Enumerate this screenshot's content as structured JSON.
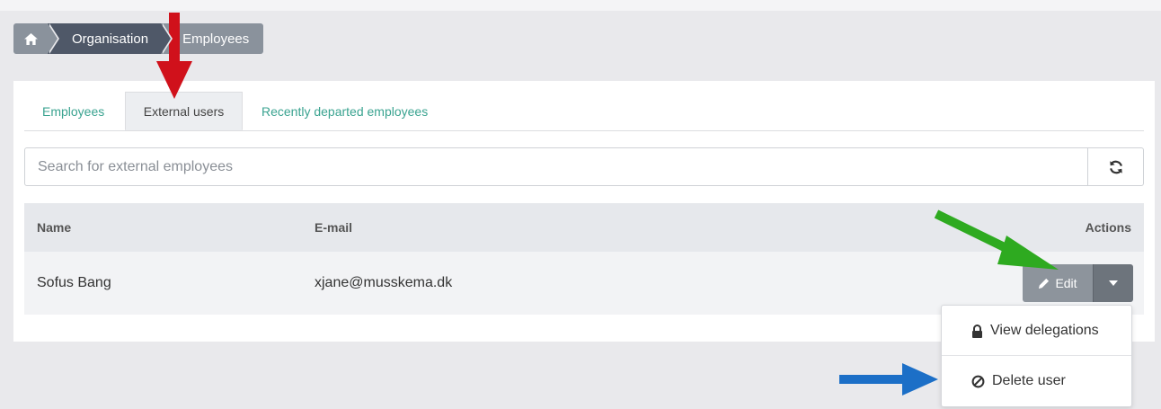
{
  "breadcrumb": {
    "home_icon": "home-icon",
    "items": [
      "Organisation",
      "Employees"
    ]
  },
  "tabs": [
    {
      "label": "Employees",
      "active": false
    },
    {
      "label": "External users",
      "active": true
    },
    {
      "label": "Recently departed employees",
      "active": false
    }
  ],
  "search": {
    "placeholder": "Search for external employees",
    "value": "",
    "refresh_icon": "refresh-icon"
  },
  "table": {
    "headers": {
      "name": "Name",
      "email": "E-mail",
      "actions": "Actions"
    },
    "rows": [
      {
        "name": "Sofus Bang",
        "email": "xjane@musskema.dk"
      }
    ]
  },
  "actions": {
    "edit_label": "Edit",
    "edit_icon": "pencil-icon",
    "caret_icon": "caret-down-icon"
  },
  "dropdown": {
    "items": [
      {
        "label": "View delegations",
        "icon": "lock-icon"
      },
      {
        "label": "Delete user",
        "icon": "ban-icon"
      }
    ]
  },
  "colors": {
    "accent_teal": "#3aa390",
    "breadcrumb_dark": "#4f5868",
    "breadcrumb_light": "#8a929c",
    "annotation_red": "#d0111b",
    "annotation_green": "#2eaa20",
    "annotation_blue": "#1c6fc7"
  }
}
